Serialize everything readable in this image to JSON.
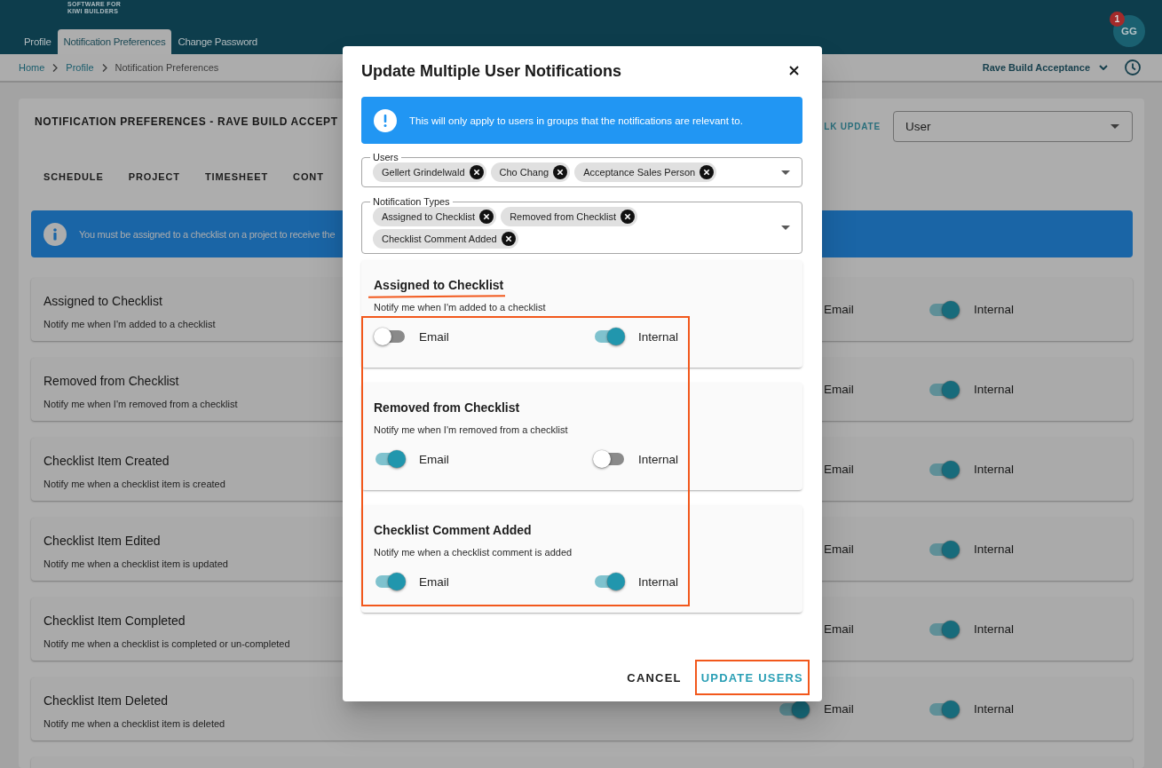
{
  "header": {
    "logo_tagline": [
      "SOFTWARE FOR",
      "KIWI BUILDERS"
    ],
    "tabs": [
      {
        "label": "Profile",
        "selected": false
      },
      {
        "label": "Notification Preferences",
        "selected": true
      },
      {
        "label": "Change Password",
        "selected": false
      }
    ],
    "avatar": {
      "initials": "GG",
      "badge": "1"
    }
  },
  "breadcrumb": {
    "items": [
      {
        "label": "Home",
        "link": true
      },
      {
        "label": "Profile",
        "link": true
      },
      {
        "label": "Notification Preferences",
        "link": false
      }
    ],
    "project": "Rave Build Acceptance"
  },
  "panel": {
    "title": "NOTIFICATION PREFERENCES - RAVE BUILD ACCEPT",
    "bulk_update": "LK UPDATE",
    "view_select": {
      "value": "User"
    },
    "tabs": [
      {
        "label": "SCHEDULE",
        "selected": false
      },
      {
        "label": "PROJECT",
        "selected": false
      },
      {
        "label": "TIMESHEET",
        "selected": false
      },
      {
        "label": "CONT",
        "selected": false
      }
    ],
    "info": "You must be assigned to a checklist on a project to receive the",
    "rows": [
      {
        "title": "Assigned to Checklist",
        "description": "Notify me when I'm added to a checklist",
        "email": {
          "label": "Email"
        },
        "internal": {
          "label": "Internal",
          "on": true
        }
      },
      {
        "title": "Removed from Checklist",
        "description": "Notify me when I'm removed from a checklist",
        "email": {
          "label": "Email"
        },
        "internal": {
          "label": "Internal",
          "on": true
        }
      },
      {
        "title": "Checklist Item Created",
        "description": "Notify me when a checklist item is created",
        "email": {
          "label": "Email"
        },
        "internal": {
          "label": "Internal",
          "on": true
        }
      },
      {
        "title": "Checklist Item Edited",
        "description": "Notify me when a checklist item is updated",
        "email": {
          "label": "Email"
        },
        "internal": {
          "label": "Internal",
          "on": true
        }
      },
      {
        "title": "Checklist Item Completed",
        "description": "Notify me when a checklist is completed or un-completed",
        "email": {
          "label": "Email"
        },
        "internal": {
          "label": "Internal",
          "on": true
        }
      },
      {
        "title": "Checklist Item Deleted",
        "description": "Notify me when a checklist item is deleted",
        "email": {
          "label": "Email",
          "on": true
        },
        "internal": {
          "label": "Internal",
          "on": true
        }
      }
    ]
  },
  "dialog": {
    "title": "Update Multiple User Notifications",
    "notice": "This will only apply to users in groups that the notifications are relevant to.",
    "fields": [
      {
        "label": "Users",
        "chips": [
          "Gellert Grindelwald",
          "Cho Chang",
          "Acceptance Sales Person"
        ]
      },
      {
        "label": "Notification Types",
        "chips": [
          "Assigned to Checklist",
          "Removed from Checklist",
          "Checklist Comment Added"
        ]
      }
    ],
    "cards": [
      {
        "title": "Assigned to Checklist",
        "description": "Notify me when I'm added to a checklist",
        "underlined": true,
        "toggles": [
          {
            "label": "Email",
            "on": false
          },
          {
            "label": "Internal",
            "on": true
          }
        ]
      },
      {
        "title": "Removed from Checklist",
        "description": "Notify me when I'm removed from a checklist",
        "underlined": false,
        "toggles": [
          {
            "label": "Email",
            "on": true
          },
          {
            "label": "Internal",
            "on": false
          }
        ]
      },
      {
        "title": "Checklist Comment Added",
        "description": "Notify me when a checklist comment is added",
        "underlined": false,
        "toggles": [
          {
            "label": "Email",
            "on": true
          },
          {
            "label": "Internal",
            "on": true
          }
        ]
      }
    ],
    "toggles_framed": true,
    "buttons": [
      {
        "label": "CANCEL",
        "kind": "text",
        "framed": false
      },
      {
        "label": "UPDATE USERS",
        "kind": "primary",
        "framed": true
      }
    ]
  }
}
